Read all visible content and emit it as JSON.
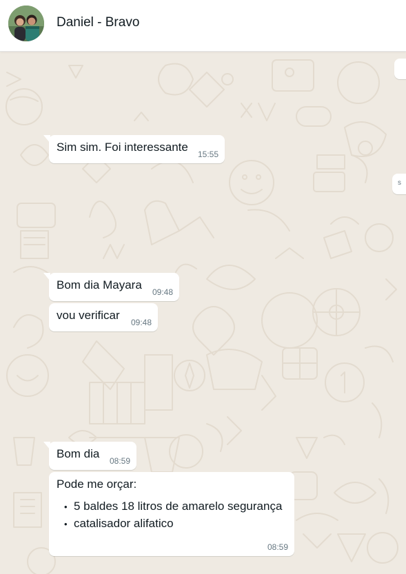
{
  "header": {
    "contact_name": "Daniel - Bravo",
    "avatar_icon": "group-photo-avatar"
  },
  "messages": [
    {
      "text": "Sim sim. Foi interessante",
      "time": "15:55"
    },
    {
      "text": "Bom dia Mayara",
      "time": "09:48"
    },
    {
      "text": "vou verificar",
      "time": "09:48"
    },
    {
      "text": "Bom dia",
      "time": "08:59"
    },
    {
      "text": "Pode me orçar:",
      "items": [
        "5 baldes 18 litros de amarelo segurança",
        "catalisador alifatico"
      ],
      "time": "08:59"
    }
  ],
  "partial_outgoing": {
    "fragment_1": "",
    "fragment_2": "s"
  },
  "colors": {
    "chat_background": "#efeae2",
    "bubble_incoming": "#ffffff",
    "timestamp": "#667781",
    "doodle": "#e4ddd2"
  }
}
